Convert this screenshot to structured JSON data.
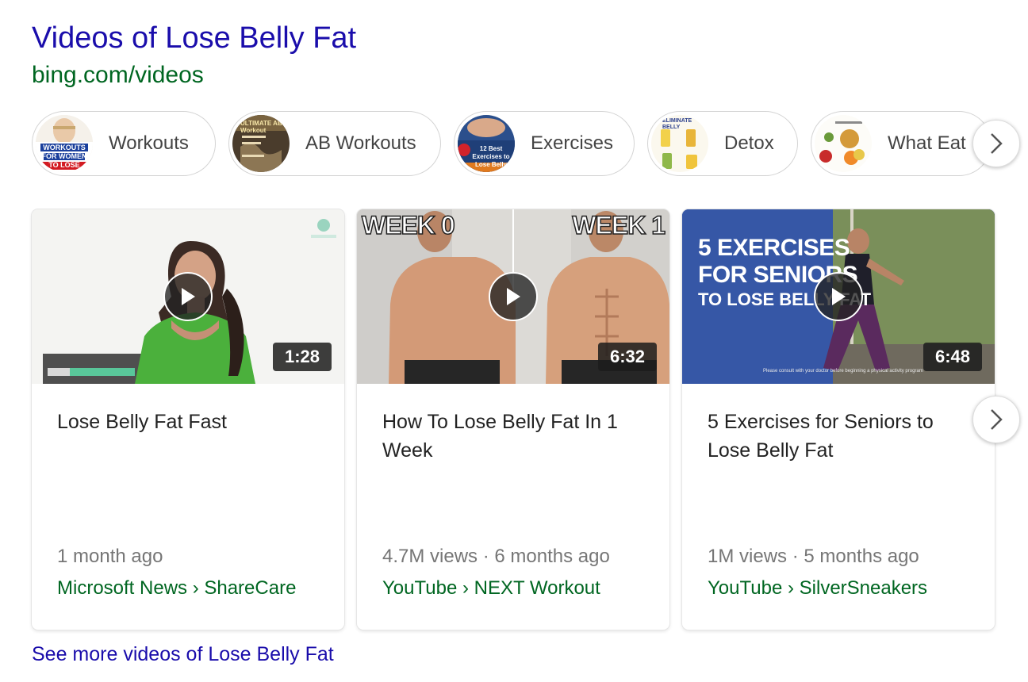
{
  "header": {
    "title": "Videos of Lose Belly Fat",
    "source": "bing.com/videos"
  },
  "pills": [
    {
      "label": "Workouts",
      "thumb_text": "WORKOUTS FOR WOMEN TO LOSE BELLY F"
    },
    {
      "label": "AB Workouts",
      "thumb_text": "ULTIMATE AB Workout"
    },
    {
      "label": "Exercises",
      "thumb_text": "12 Best Exercises to Lose Belly"
    },
    {
      "label": "Detox",
      "thumb_text": "ELIMINATE BELLY"
    },
    {
      "label": "What Eat",
      "thumb_text": ""
    }
  ],
  "pills_next_icon": "chevron-right-icon",
  "cards": [
    {
      "title": "Lose Belly Fat Fast",
      "duration": "1:28",
      "meta": "1 month ago",
      "source": "Microsoft News › ShareCare",
      "thumb_text": ""
    },
    {
      "title": "How To Lose Belly Fat In 1 Week",
      "duration": "6:32",
      "meta": "4.7M views · 6 months ago",
      "source": "YouTube › NEXT Workout",
      "thumb_text_left": "WEEK 0",
      "thumb_text_right": "WEEK 1"
    },
    {
      "title": "5 Exercises for Seniors to Lose Belly Fat",
      "duration": "6:48",
      "meta": "1M views · 5 months ago",
      "source": "YouTube › SilverSneakers",
      "thumb_text_lines": [
        "5 EXERCISES",
        "FOR SENIORS",
        "TO LOSE BELLY FAT"
      ],
      "thumb_caption": "Please consult with your doctor before beginning a physical activity program"
    }
  ],
  "see_more": "See more videos of Lose Belly Fat",
  "colors": {
    "link": "#1a0dab",
    "source_green": "#006621",
    "meta_gray": "#767676"
  }
}
